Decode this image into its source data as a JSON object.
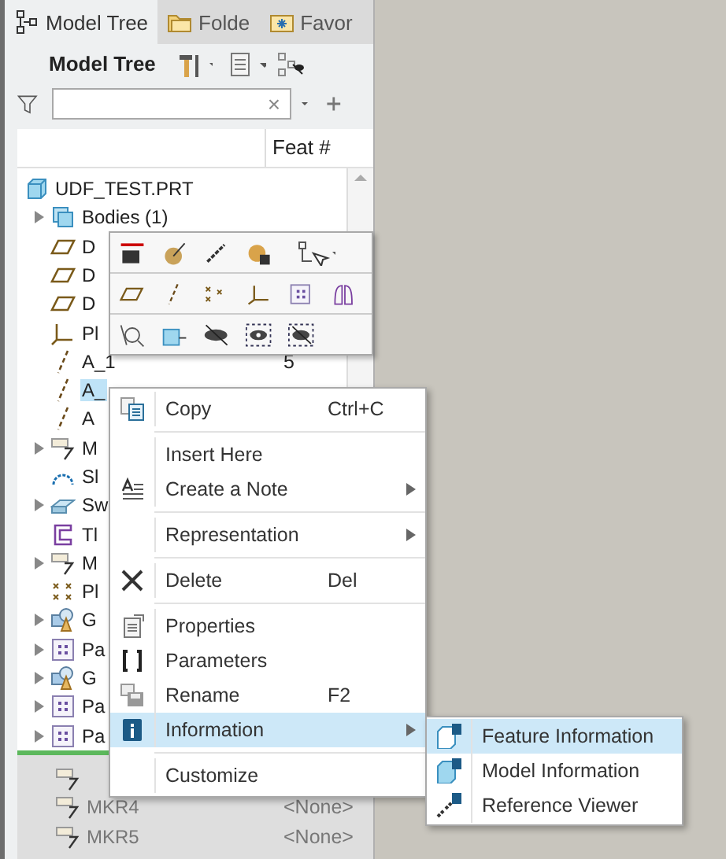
{
  "tabs": [
    {
      "label": "Model Tree",
      "selected": true
    },
    {
      "label": "Folde",
      "selected": false
    },
    {
      "label": "Favor",
      "selected": false
    }
  ],
  "toolbar": {
    "title": "Model Tree"
  },
  "search": {
    "clear": "×"
  },
  "table": {
    "columns": [
      {
        "label": "Feat #"
      }
    ],
    "rows": [
      {
        "label": "UDF_TEST.PRT",
        "kind": "part",
        "expandable": false,
        "selected": false
      },
      {
        "label": "Bodies (1)",
        "kind": "bodies",
        "expandable": true,
        "selected": false
      },
      {
        "label": "D",
        "kind": "plane",
        "expandable": false,
        "selected": false
      },
      {
        "label": "D",
        "kind": "plane",
        "expandable": false,
        "selected": false
      },
      {
        "label": "D",
        "kind": "plane",
        "expandable": false,
        "selected": false
      },
      {
        "label": "Pl",
        "kind": "csys",
        "expandable": false,
        "selected": false
      },
      {
        "label": "A_1",
        "feat": "5",
        "kind": "axis",
        "expandable": false,
        "selected": false
      },
      {
        "label": "A_",
        "kind": "axis",
        "expandable": false,
        "selected": true
      },
      {
        "label": "A",
        "kind": "axis",
        "expandable": false,
        "selected": false
      },
      {
        "label": "M",
        "kind": "marker",
        "expandable": true,
        "selected": false
      },
      {
        "label": "Sl",
        "kind": "sketch",
        "expandable": false,
        "selected": false
      },
      {
        "label": "Sw",
        "kind": "sweep",
        "expandable": true,
        "selected": false
      },
      {
        "label": "Tl",
        "kind": "trim",
        "expandable": false,
        "selected": false
      },
      {
        "label": "M",
        "kind": "marker",
        "expandable": true,
        "selected": false
      },
      {
        "label": "Pl",
        "kind": "points",
        "expandable": false,
        "selected": false
      },
      {
        "label": "G",
        "kind": "group",
        "expandable": true,
        "selected": false
      },
      {
        "label": "Pa",
        "kind": "pattern",
        "expandable": true,
        "selected": false
      },
      {
        "label": "G",
        "kind": "group",
        "expandable": true,
        "selected": false
      },
      {
        "label": "Pa",
        "kind": "pattern",
        "expandable": true,
        "selected": false
      },
      {
        "label": "Pa",
        "kind": "pattern",
        "expandable": true,
        "selected": false
      }
    ],
    "inactive_rows": [
      {},
      {
        "label": "MKR4",
        "feat": "<None>"
      },
      {
        "label": "MKR5",
        "feat": "<None>"
      }
    ]
  },
  "context_menu": {
    "items": [
      {
        "kind": "item",
        "label": "Copy",
        "shortcut": "Ctrl+C",
        "submenu": false,
        "selected": false
      },
      {
        "kind": "separator"
      },
      {
        "kind": "item",
        "label": "Insert Here",
        "submenu": false,
        "selected": false
      },
      {
        "kind": "item",
        "label": "Create a Note",
        "submenu": true,
        "selected": false
      },
      {
        "kind": "separator"
      },
      {
        "kind": "item",
        "label": "Representation",
        "submenu": true,
        "selected": false
      },
      {
        "kind": "separator"
      },
      {
        "kind": "item",
        "label": "Delete",
        "shortcut": "Del",
        "submenu": false,
        "selected": false
      },
      {
        "kind": "separator"
      },
      {
        "kind": "item",
        "label": "Properties",
        "submenu": false,
        "selected": false
      },
      {
        "kind": "item",
        "label": "Parameters",
        "submenu": false,
        "selected": false
      },
      {
        "kind": "item",
        "label": "Rename",
        "shortcut": "F2",
        "submenu": false,
        "selected": false
      },
      {
        "kind": "item",
        "label": "Information",
        "submenu": true,
        "selected": true
      },
      {
        "kind": "separator"
      },
      {
        "kind": "item",
        "label": "Customize",
        "submenu": false,
        "selected": false
      }
    ]
  },
  "submenu": {
    "items": [
      {
        "label": "Feature Information",
        "selected": true
      },
      {
        "label": "Model Information",
        "selected": false
      },
      {
        "label": "Reference Viewer",
        "selected": false
      }
    ]
  }
}
